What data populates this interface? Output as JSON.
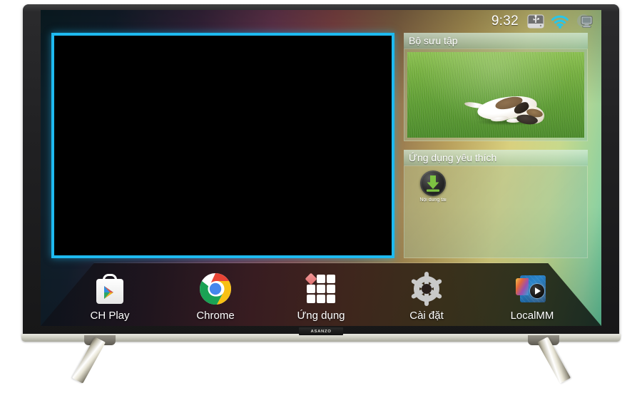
{
  "device": {
    "brand": "ASANZO",
    "type": "smart-tv"
  },
  "status_bar": {
    "clock": "9:32",
    "icons": [
      {
        "name": "usb-drive-icon",
        "label": "USB"
      },
      {
        "name": "wifi-icon",
        "label": "Wi-Fi"
      },
      {
        "name": "display-icon",
        "label": "Display"
      }
    ]
  },
  "video_panel": {
    "title": "",
    "highlight_color": "#1ebaf0",
    "content": ""
  },
  "panels": [
    {
      "id": "collection",
      "title": "Bộ sưu tập",
      "item_caption": ""
    },
    {
      "id": "favorites",
      "title": "Ứng dụng yêu thích",
      "items": [
        {
          "name": "download-content",
          "label": "Nội dung tải"
        }
      ]
    }
  ],
  "dock": {
    "items": [
      {
        "id": "ch-play",
        "label": "CH Play",
        "icon": "google-play-icon"
      },
      {
        "id": "chrome",
        "label": "Chrome",
        "icon": "chrome-icon"
      },
      {
        "id": "apps",
        "label": "Ứng dụng",
        "icon": "apps-grid-icon"
      },
      {
        "id": "settings",
        "label": "Cài đặt",
        "icon": "gear-icon"
      },
      {
        "id": "localmm",
        "label": "LocalMM",
        "icon": "media-player-icon"
      }
    ]
  },
  "colors": {
    "highlight": "#1ebaf0",
    "wifi": "#29c5e8",
    "panel_header": "#d7f0e1",
    "dock_text": "#ffffff"
  }
}
